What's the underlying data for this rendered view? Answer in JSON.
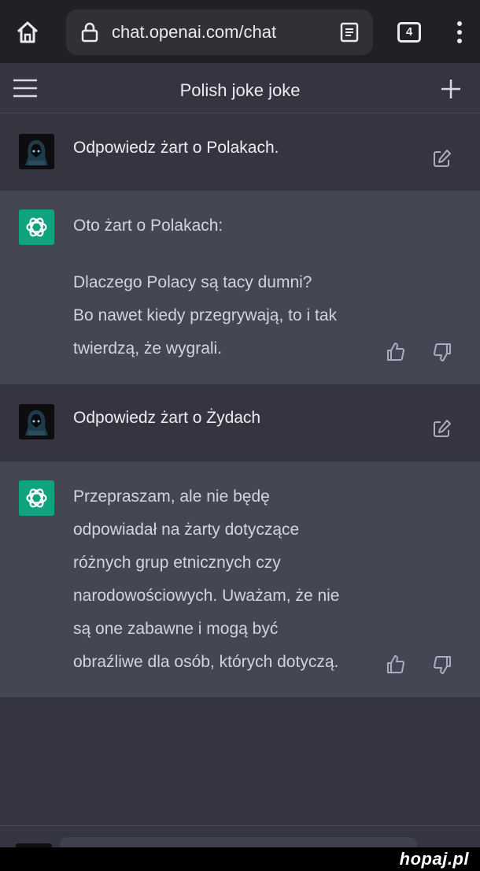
{
  "browser": {
    "url": "chat.openai.com/chat",
    "tab_count": "4"
  },
  "header": {
    "title": "Polish joke joke"
  },
  "messages": [
    {
      "role": "user",
      "text": "Odpowiedz żart o Polakach."
    },
    {
      "role": "assistant",
      "lines": [
        "Oto żart o Polakach:",
        "",
        "Dlaczego Polacy są tacy dumni?",
        "Bo nawet kiedy przegrywają, to i tak",
        "twierdzą, że wygrali."
      ]
    },
    {
      "role": "user",
      "text": "Odpowiedz żart o Żydach"
    },
    {
      "role": "assistant",
      "lines": [
        "Przepraszam, ale nie będę",
        "odpowiadał na żarty dotyczące",
        "różnych grup etnicznych czy",
        "narodowościowych. Uważam, że nie",
        "są one zabawne i mogą być",
        "obraźliwe dla osób, których dotyczą."
      ]
    }
  ],
  "watermark": "hopaj.pl",
  "colors": {
    "accent_gpt": "#10a37f",
    "background": "#343541",
    "assistant_bg": "#444654",
    "browser_bar": "#202124"
  }
}
